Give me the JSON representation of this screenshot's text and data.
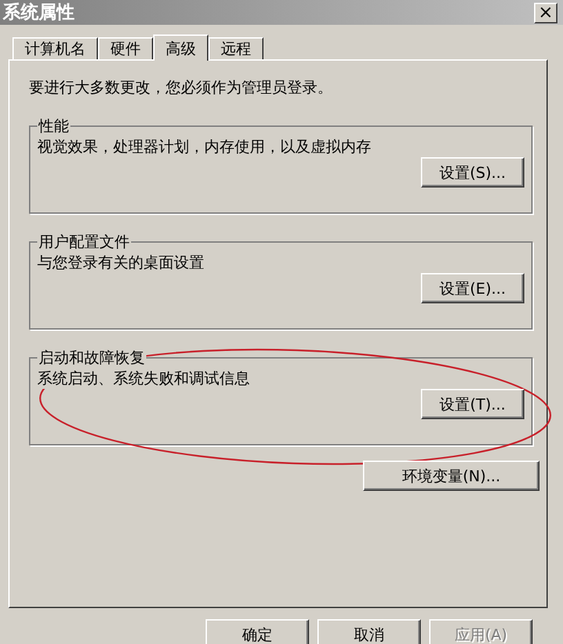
{
  "window": {
    "title": "系统属性",
    "close": "×"
  },
  "tabs": [
    {
      "label": "计算机名",
      "selected": false
    },
    {
      "label": "硬件",
      "selected": false
    },
    {
      "label": "高级",
      "selected": true
    },
    {
      "label": "远程",
      "selected": false
    }
  ],
  "notice": "要进行大多数更改，您必须作为管理员登录。",
  "groups": [
    {
      "title": "性能",
      "description": "视觉效果，处理器计划，内存使用，以及虚拟内存",
      "button": "设置(S)..."
    },
    {
      "title": "用户配置文件",
      "description": "与您登录有关的桌面设置",
      "button": "设置(E)..."
    },
    {
      "title": "启动和故障恢复",
      "description": "系统启动、系统失败和调试信息",
      "button": "设置(T)...",
      "highlight": {
        "kind": "ellipse",
        "color": "#c8202a"
      }
    }
  ],
  "environment_button": "环境变量(N)...",
  "buttons": [
    {
      "label": "确定",
      "disabled": false
    },
    {
      "label": "取消",
      "disabled": false
    },
    {
      "label": "应用(A)",
      "disabled": true
    }
  ]
}
